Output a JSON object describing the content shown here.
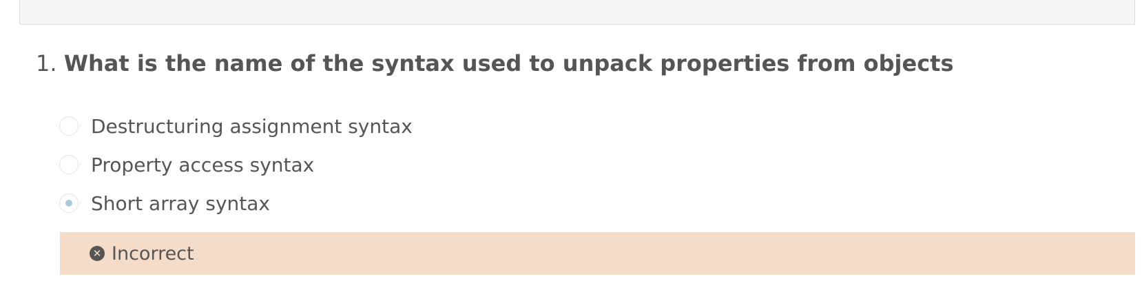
{
  "question": {
    "number": "1.",
    "text": "What is the name of the syntax used to unpack properties from objects"
  },
  "options": [
    {
      "label": "Destructuring assignment syntax",
      "selected": false
    },
    {
      "label": "Property access syntax",
      "selected": false
    },
    {
      "label": "Short array syntax",
      "selected": true
    }
  ],
  "feedback": {
    "icon": "x-circle-icon",
    "label": "Incorrect"
  }
}
